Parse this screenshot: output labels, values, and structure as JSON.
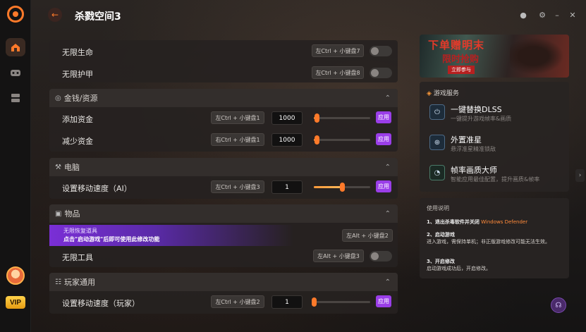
{
  "app": {
    "title": "杀戮空间3",
    "vip_label": "VIP"
  },
  "window_controls": [
    "record-icon",
    "settings-icon",
    "minimize-icon",
    "close-icon"
  ],
  "sidebar": [
    "home-icon",
    "games-icon",
    "storage-icon"
  ],
  "sections": {
    "top": {
      "rows": [
        {
          "label": "无限生命",
          "hotkey": "左Ctrl + 小键盘7",
          "toggle": false
        },
        {
          "label": "无限护甲",
          "hotkey": "左Ctrl + 小键盘8",
          "toggle": false
        }
      ]
    },
    "money": {
      "title": "金钱/资源",
      "rows": [
        {
          "label": "添加资金",
          "hotkey": "左Ctrl + 小键盘1",
          "value": "1000",
          "slider_fraction": 0.05,
          "apply": "应用"
        },
        {
          "label": "减少资金",
          "hotkey": "右Ctrl + 小键盘1",
          "value": "1000",
          "slider_fraction": 0.05,
          "apply": "应用"
        }
      ]
    },
    "computer": {
      "title": "电脑",
      "rows": [
        {
          "label": "设置移动速度（AI）",
          "hotkey": "左Ctrl + 小键盘3",
          "value": "1",
          "slider_fraction": 0.5,
          "apply": "应用"
        }
      ]
    },
    "items": {
      "title": "物品",
      "banner_line1": "无限恢复道具",
      "banner_line2": "点击\"启动游戏\"后即可使用此修改功能",
      "banner_hotkey": "左Alt + 小键盘2",
      "rows": [
        {
          "label": "无限工具",
          "hotkey": "左Alt + 小键盘3",
          "toggle": false
        }
      ]
    },
    "player": {
      "title": "玩家通用",
      "rows": [
        {
          "label": "设置移动速度（玩家）",
          "hotkey": "左Ctrl + 小键盘2",
          "value": "1",
          "slider_fraction": 0.0,
          "apply": "应用"
        }
      ]
    }
  },
  "promo": {
    "line1": "下单赠明末",
    "line2": "限时抢购",
    "line3": "立即参与"
  },
  "services": {
    "title": "游戏服务",
    "items": [
      {
        "name": "一键替换DLSS",
        "desc": "一键提升游戏帧率&画质"
      },
      {
        "name": "外置准星",
        "desc": "悬浮准星精准锁敌"
      },
      {
        "name": "帧率画质大师",
        "desc": "智能应用最佳配置，提升画质&帧率"
      }
    ]
  },
  "notes": {
    "title": "使用说明",
    "n1_title": "1、退出杀毒软件并关闭",
    "n1_highlight": "Windows Defender",
    "n2_title": "2、启动游戏",
    "n2_text": "进入游戏，需保持单机；非正版游戏修改可能无法生效。",
    "n3_title": "3、开启修改",
    "n3_text": "启动游戏成功后，开启修改。"
  },
  "colors": {
    "accent": "#ff7a2a",
    "apply": "#9a3ee8",
    "vip": "#ffc22a"
  }
}
